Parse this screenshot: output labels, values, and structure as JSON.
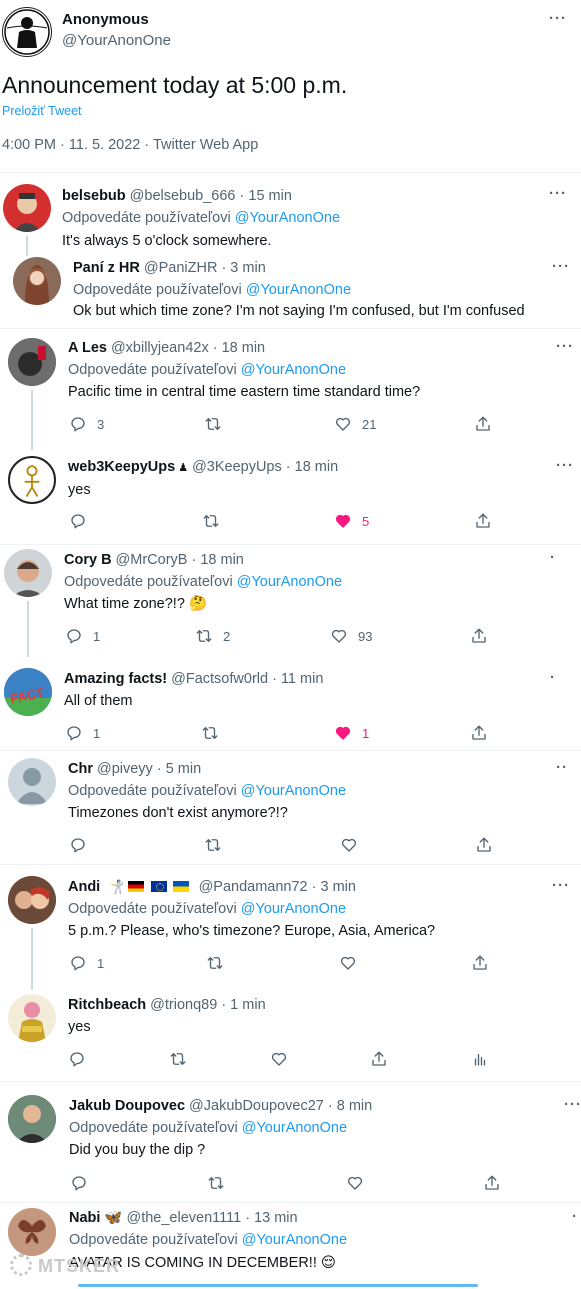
{
  "tweet": {
    "name": "Anonymous",
    "handle": "@YourAnonOne",
    "text": "Announcement today at 5:00 p.m.",
    "translate": "Preložiť Tweet",
    "timestamp": "4:00 PM · 11. 5. 2022 · Twitter Web App"
  },
  "replying_prefix": "Odpovedáte používateľovi",
  "replying_target": "@YourAnonOne",
  "replies": [
    {
      "name": "belsebub",
      "meta": "@belsebub_666 · 15 min",
      "text": "It's always 5 o'clock somewhere."
    },
    {
      "name": "Paní z HR",
      "meta": "@PaniZHR · 3 min",
      "text": "Ok but which time zone? I'm not saying I'm confused, but I'm confused"
    },
    {
      "name": "A Les",
      "meta": "@xbillyjean42x · 18 min",
      "text": "Pacific time in central time eastern time standard time?",
      "replies": "3",
      "likes": "21"
    },
    {
      "name": "web3KeepyUps",
      "meta": "@3KeepyUps · 18 min",
      "text": "yes",
      "likes": "5"
    },
    {
      "name": "Cory B",
      "meta": "@MrCoryB · 18 min",
      "text": "What time zone?!?",
      "emoji": "🤔",
      "replies": "1",
      "retweets": "2",
      "likes": "93"
    },
    {
      "name": "Amazing facts!",
      "meta": "@Factsofw0rld · 11 min",
      "text": "All of them",
      "replies": "1",
      "likes": "1"
    },
    {
      "name": "Chr",
      "meta": "@piveyy · 5 min",
      "text": "Timezones don't exist anymore?!?"
    },
    {
      "name": "Andi",
      "meta": "@Pandamann72 · 3 min",
      "text": "5 p.m.? Please, who's timezone? Europe, Asia, America?",
      "replies": "1"
    },
    {
      "name": "Ritchbeach",
      "meta": "@trionq89 · 1 min",
      "text": "yes"
    },
    {
      "name": "Jakub Doupovec",
      "meta": "@JakubDoupovec27 · 8 min",
      "text": "Did you buy the dip ?"
    },
    {
      "name": "Nabi",
      "meta": "@the_eleven1111 · 13 min",
      "text": "AVATAR IS COMING IN DECEMBER!!",
      "emoji": "😌"
    }
  ],
  "watermark": "MTSKER",
  "colors": {
    "accent": "#1d9bf0",
    "like": "#f91880",
    "secondary": "#536471"
  }
}
